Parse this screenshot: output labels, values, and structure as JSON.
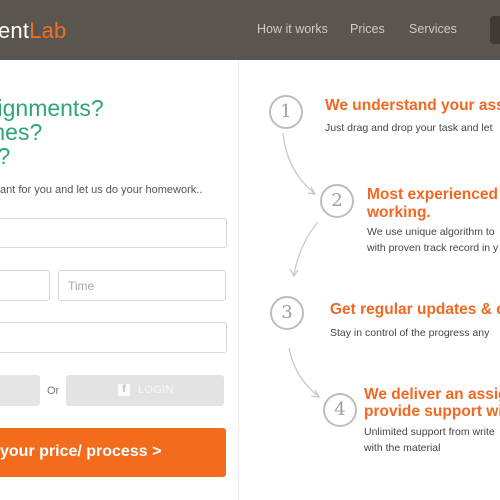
{
  "header": {
    "logo_main": "ent",
    "logo_accent": "Lab",
    "nav": [
      "How it works",
      "Prices",
      "Services"
    ]
  },
  "left": {
    "headline": [
      "signments?",
      "mes?",
      "k?"
    ],
    "subtext": "ant for you and let us do your homework..",
    "time_placeholder": "Time",
    "or_label": "Or",
    "login_label": "LOGIN",
    "fb_glyph": "f",
    "cta_label": "your price/ process >"
  },
  "steps": [
    {
      "num": "1",
      "title": [
        "We understand your ass"
      ],
      "desc": [
        "Just drag and drop your task and let"
      ]
    },
    {
      "num": "2",
      "title": [
        "Most experienced",
        "working."
      ],
      "desc": [
        "We use unique algorithm to",
        "with proven track record in y"
      ]
    },
    {
      "num": "3",
      "title": [
        "Get regular updates & d"
      ],
      "desc": [
        "Stay in control of the progress any"
      ]
    },
    {
      "num": "4",
      "title": [
        "We deliver an assig",
        "provide support wi"
      ],
      "desc": [
        "Unlimited support from write",
        "with the material"
      ]
    }
  ],
  "colors": {
    "accent": "#f26822",
    "headline": "#2fa37c",
    "header_bg": "#5b5550"
  }
}
